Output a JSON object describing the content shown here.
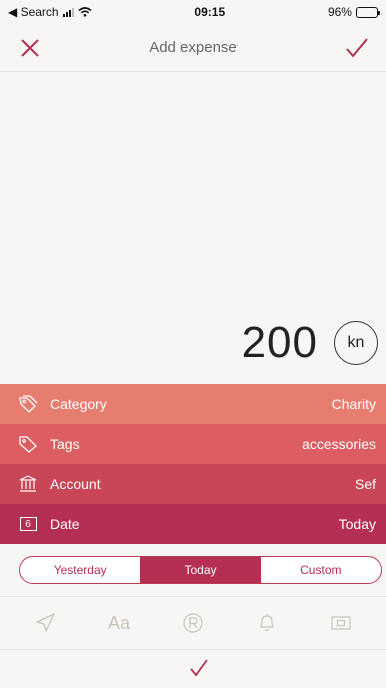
{
  "status_bar": {
    "back_label": "◀ Search",
    "time": "09:15",
    "battery": "96%"
  },
  "nav": {
    "title": "Add expense",
    "close_icon": "close-icon",
    "confirm_icon": "checkmark-icon"
  },
  "amount": {
    "value": "200",
    "currency": "kn"
  },
  "fields": {
    "category": {
      "label": "Category",
      "value": "Charity"
    },
    "tags": {
      "label": "Tags",
      "value": "accessories"
    },
    "account": {
      "label": "Account",
      "value": "Sef"
    },
    "date": {
      "label": "Date",
      "value": "Today",
      "icon_day": "6"
    }
  },
  "date_options": {
    "yesterday": "Yesterday",
    "today": "Today",
    "custom": "Custom",
    "selected": "Today"
  },
  "toolbar": {
    "location": "location-arrow-icon",
    "note": "Aa",
    "recurring": "recurring-icon",
    "reminder": "bell-icon",
    "photo": "camera-icon"
  },
  "colors": {
    "accent": "#b42f52",
    "category_row": "#e77d6f",
    "tags_row": "#dd5e62",
    "account_row": "#c94657",
    "date_row": "#b42f52"
  }
}
